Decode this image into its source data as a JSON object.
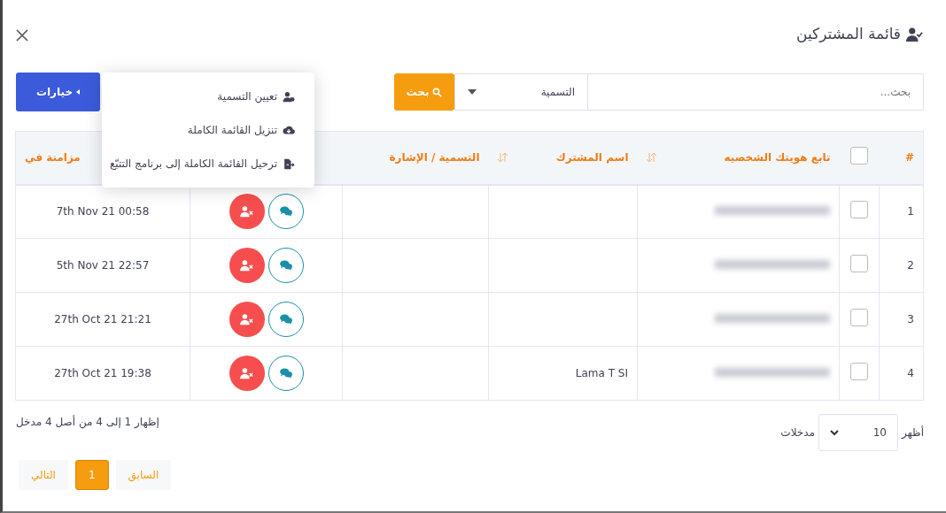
{
  "modal": {
    "title": "قائمة المشتركين"
  },
  "search": {
    "placeholder": "بحث...",
    "filter": "التسمية",
    "button": "بحث"
  },
  "options_button": "خيارات",
  "options_menu": [
    {
      "label": "تعيين التسمية",
      "kind": "tag"
    },
    {
      "label": "تنزيل القائمة الكاملة",
      "kind": "download"
    },
    {
      "label": "ترحيل القائمة الكاملة إلى برنامج التتبّع",
      "kind": "export"
    }
  ],
  "table": {
    "columns": [
      {
        "label": "#"
      },
      {
        "kind": "checkbox",
        "checked": false
      },
      {
        "label": "تابع هويتك الشخصيه",
        "sortable": true
      },
      {
        "label": "اسم المشترك",
        "sortable": true
      },
      {
        "label": "التسمية / الإشارة"
      },
      {
        "kind": "actions"
      },
      {
        "label": "مزامنة في"
      }
    ],
    "rows": [
      {
        "index": "1",
        "checked": false,
        "sync": "7th Nov 21 00:58"
      },
      {
        "index": "2",
        "checked": false,
        "sync": "5th Nov 21 22:57"
      },
      {
        "index": "3",
        "checked": false,
        "sync": "27th Oct 21 21:21"
      },
      {
        "index": "4",
        "checked": false,
        "name": "Lama T SI",
        "sync": "27th Oct 21 19:38"
      }
    ]
  },
  "length": {
    "prefix": "أظهر",
    "value": "10",
    "suffix": "مدخلات"
  },
  "info": "إظهار 1 إلى 4 من أصل 4 مدخل",
  "pagination": [
    {
      "label": "السابق",
      "selected": false
    },
    {
      "label": "1",
      "selected": true
    },
    {
      "label": "التالي",
      "selected": false
    }
  ]
}
